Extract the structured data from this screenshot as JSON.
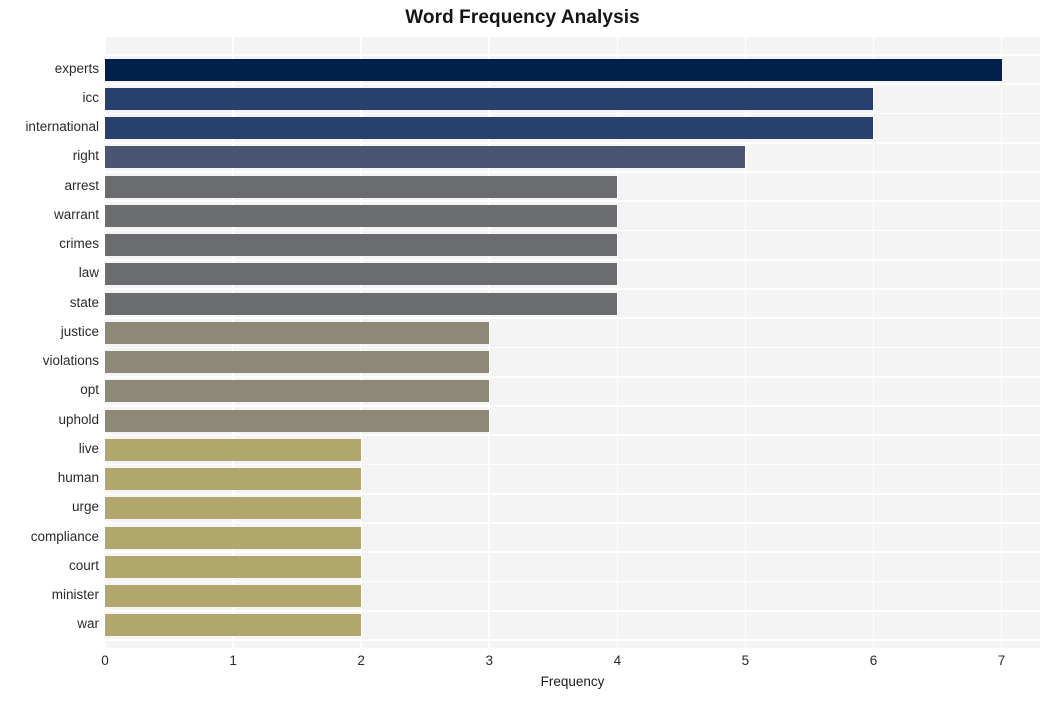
{
  "chart_data": {
    "type": "bar",
    "orientation": "horizontal",
    "title": "Word Frequency Analysis",
    "xlabel": "Frequency",
    "ylabel": "",
    "xlim": [
      0,
      7.3
    ],
    "xticks": [
      "0",
      "1",
      "2",
      "3",
      "4",
      "5",
      "6",
      "7"
    ],
    "xtick_values": [
      0,
      1,
      2,
      3,
      4,
      5,
      6,
      7
    ],
    "grid": true,
    "legend": "none",
    "categories": [
      "experts",
      "icc",
      "international",
      "right",
      "arrest",
      "warrant",
      "crimes",
      "law",
      "state",
      "justice",
      "violations",
      "opt",
      "uphold",
      "live",
      "human",
      "urge",
      "compliance",
      "court",
      "minister",
      "war"
    ],
    "values": [
      7,
      6,
      6,
      5,
      4,
      4,
      4,
      4,
      4,
      3,
      3,
      3,
      3,
      2,
      2,
      2,
      2,
      2,
      2,
      2
    ],
    "bar_colors": [
      "#02204a",
      "#27406e",
      "#27406e",
      "#4b5470",
      "#6b6c70",
      "#6b6c70",
      "#6b6c70",
      "#6b6c70",
      "#6b6c70",
      "#8d8878",
      "#8d8878",
      "#8d8878",
      "#8d8878",
      "#b1a66c",
      "#b1a66c",
      "#b1a66c",
      "#b1a66c",
      "#b1a66c",
      "#b1a66c",
      "#b1a66c"
    ],
    "plot_background": "#f4f4f5",
    "grid_color": "#ffffff",
    "figure_background": "#ffffff"
  }
}
